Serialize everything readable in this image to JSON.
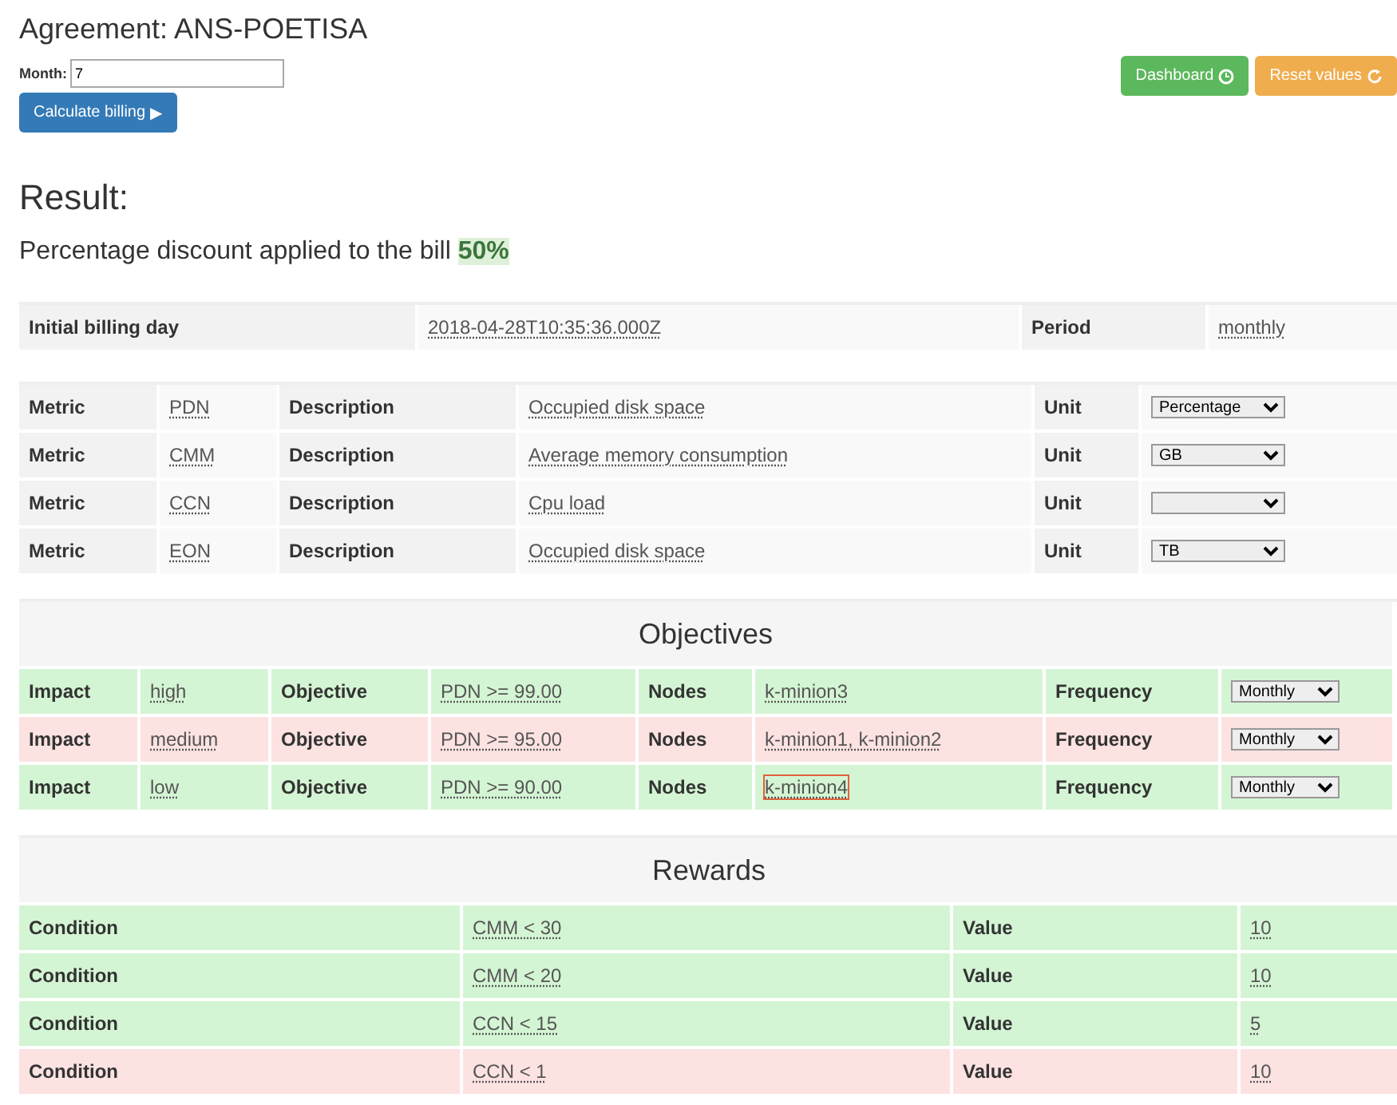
{
  "title": "Agreement: ANS-POETISA",
  "month": {
    "label": "Month:",
    "value": "7"
  },
  "buttons": [
    {
      "kind": "calculate",
      "label": "Calculate billing",
      "icon": "▶"
    },
    {
      "kind": "dashboard",
      "label": "Dashboard"
    },
    {
      "kind": "reset",
      "label": "Reset values"
    }
  ],
  "result": {
    "heading": "Result:",
    "text": "Percentage discount applied to the bill",
    "value": "50%"
  },
  "billing": {
    "label": "Initial billing day",
    "value": "2018-04-28T10:35:36.000Z",
    "period_label": "Period",
    "period": "monthly"
  },
  "metrics": [
    {
      "metric_label": "Metric",
      "metric": "PDN",
      "description_label": "Description",
      "description": "Occupied disk space",
      "unit_label": "Unit",
      "unit": "Percentage"
    },
    {
      "metric_label": "Metric",
      "metric": "CMM",
      "description_label": "Description",
      "description": "Average memory consumption",
      "unit_label": "Unit",
      "unit": "GB"
    },
    {
      "metric_label": "Metric",
      "metric": "CCN",
      "description_label": "Description",
      "description": "Cpu load",
      "unit_label": "Unit"
    },
    {
      "metric_label": "Metric",
      "metric": "EON",
      "description_label": "Description",
      "description": "Occupied disk space",
      "unit_label": "Unit",
      "unit": "TB"
    }
  ],
  "objectives": {
    "heading": "Objectives",
    "rows": [
      {
        "fulfilled": true,
        "impact_label": "Impact",
        "impact": "high",
        "objective_label": "Objective",
        "objective": "PDN >= 99.00",
        "nodes_label": "Nodes",
        "nodes": "k-minion3",
        "nodes_outlined": false,
        "frequency_label": "Frequency",
        "frequency": "Monthly"
      },
      {
        "fulfilled": false,
        "impact_label": "Impact",
        "impact": "medium",
        "objective_label": "Objective",
        "objective": "PDN >= 95.00",
        "nodes_label": "Nodes",
        "nodes": "k-minion1, k-minion2",
        "nodes_outlined": false,
        "frequency_label": "Frequency",
        "frequency": "Monthly"
      },
      {
        "fulfilled": true,
        "impact_label": "Impact",
        "impact": "low",
        "objective_label": "Objective",
        "objective": "PDN >= 90.00",
        "nodes_label": "Nodes",
        "nodes": "k-minion4",
        "nodes_outlined": true,
        "frequency_label": "Frequency",
        "frequency": "Monthly"
      }
    ]
  },
  "rewards": {
    "heading": "Rewards",
    "rows": [
      {
        "fulfilled": true,
        "condition_label": "Condition",
        "condition": "CMM < 30",
        "value_label": "Value",
        "value": "10"
      },
      {
        "fulfilled": true,
        "condition_label": "Condition",
        "condition": "CMM < 20",
        "value_label": "Value",
        "value": "10"
      },
      {
        "fulfilled": true,
        "condition_label": "Condition",
        "condition": "CCN < 15",
        "value_label": "Value",
        "value": "5"
      },
      {
        "fulfilled": false,
        "condition_label": "Condition",
        "condition": "CCN < 1",
        "value_label": "Value",
        "value": "10"
      }
    ]
  }
}
